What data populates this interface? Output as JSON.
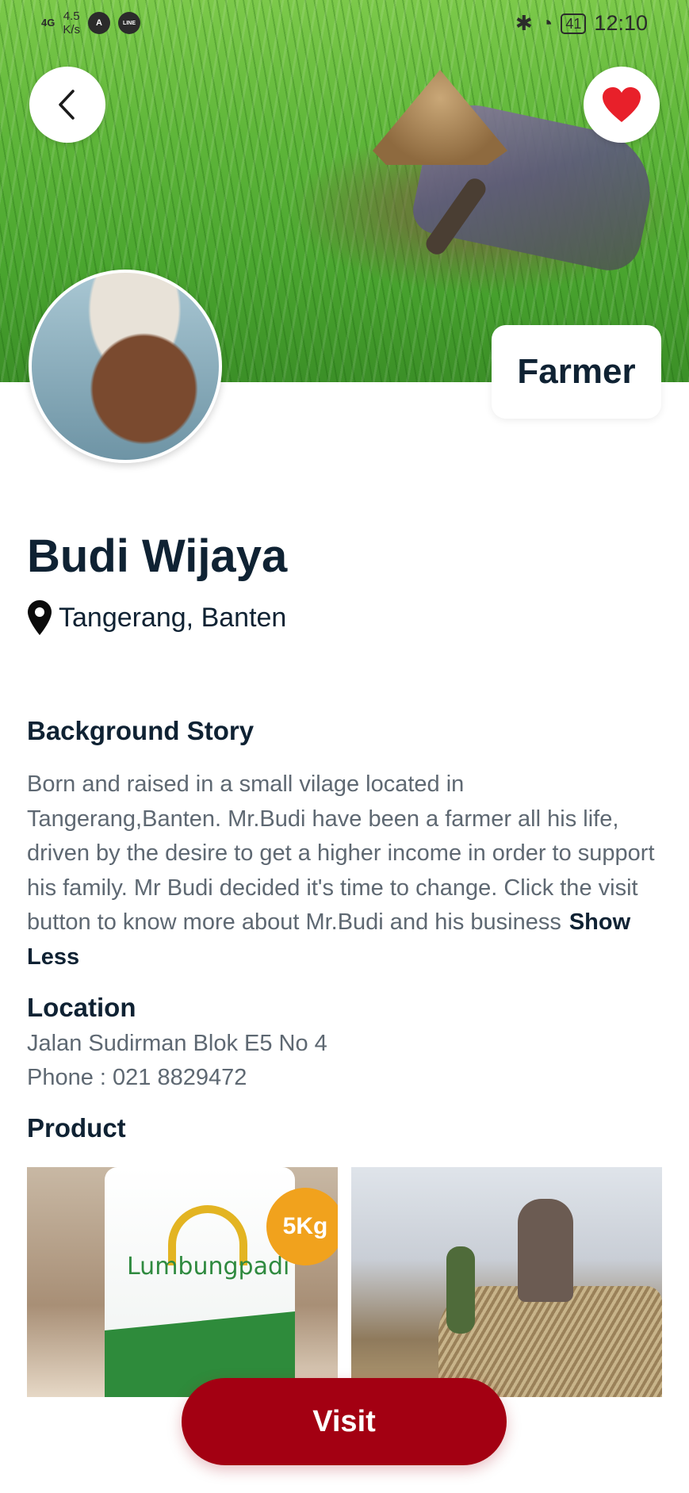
{
  "status_bar": {
    "network": "4G",
    "speed_value": "4.5",
    "speed_unit": "K/s",
    "app_icon_1": "A",
    "app_icon_2": "LINE",
    "battery": "41",
    "time": "12:10"
  },
  "hero": {
    "role_tag": "Farmer"
  },
  "profile": {
    "name": "Budi Wijaya",
    "location": "Tangerang, Banten"
  },
  "background_story": {
    "title": "Background Story",
    "text": "Born and raised in a small vilage located in Tangerang,Banten. Mr.Budi have been a farmer all his life, driven by the desire to get a higher income in order to support his family. Mr Budi decided it's time to change. Click the visit button to know more about Mr.Budi and his business",
    "toggle_label": "Show Less"
  },
  "location_section": {
    "title": "Location",
    "address": "Jalan Sudirman Blok E5 No 4",
    "phone": "Phone : 021 8829472"
  },
  "product_section": {
    "title": "Product",
    "product_1_brand": "Lumbungpadi",
    "product_1_badge": "5Kg"
  },
  "actions": {
    "visit_label": "Visit"
  },
  "colors": {
    "primary": "#a30012",
    "heading": "#0f2233",
    "body_text": "#5e6872",
    "favorite": "#e8202a"
  }
}
